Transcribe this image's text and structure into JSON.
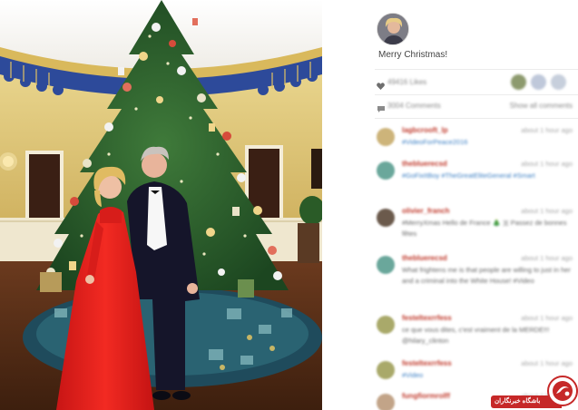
{
  "post": {
    "caption": "Merry Christmas!",
    "likes_text": "49416 Likes",
    "comments_count_text": "3004 Comments",
    "show_all_label": "Show all comments"
  },
  "comments": [
    {
      "user": "lagbcrooft_lp",
      "time": "about 1 hour ago",
      "text": "#VideoForPeace2016"
    },
    {
      "user": "thebluerecsd",
      "time": "about 1 hour ago",
      "text": "#GoFixItBoy #TheGreatEliteGeneral #Smart"
    },
    {
      "user": "olivier_franch",
      "time": "about 1 hour ago",
      "text": "#MerryXmas Hello de France 🎄 🇧 Passez de bonnes fêtes"
    },
    {
      "user": "thebluerecsd",
      "time": "about 1 hour ago",
      "text": "What frightens me is that people are willing to just in her and a criminal into the White House! #Video"
    },
    {
      "user": "festeltexrrfess",
      "time": "about 1 hour ago",
      "text": "ce que vous dites, c'est vraiment de la MERDE!!! @hilary_clinton"
    },
    {
      "user": "festeltexrrfess",
      "time": "about 1 hour ago",
      "text": "#Video"
    },
    {
      "user": "fungfiormrolff",
      "time": "about 1 hour ago",
      "text": ""
    }
  ],
  "watermark": {
    "text": "باشگاه خبرنگاران",
    "color": "#c62828"
  },
  "colors": {
    "username": "#c0392b",
    "link": "#3b7fc4"
  }
}
